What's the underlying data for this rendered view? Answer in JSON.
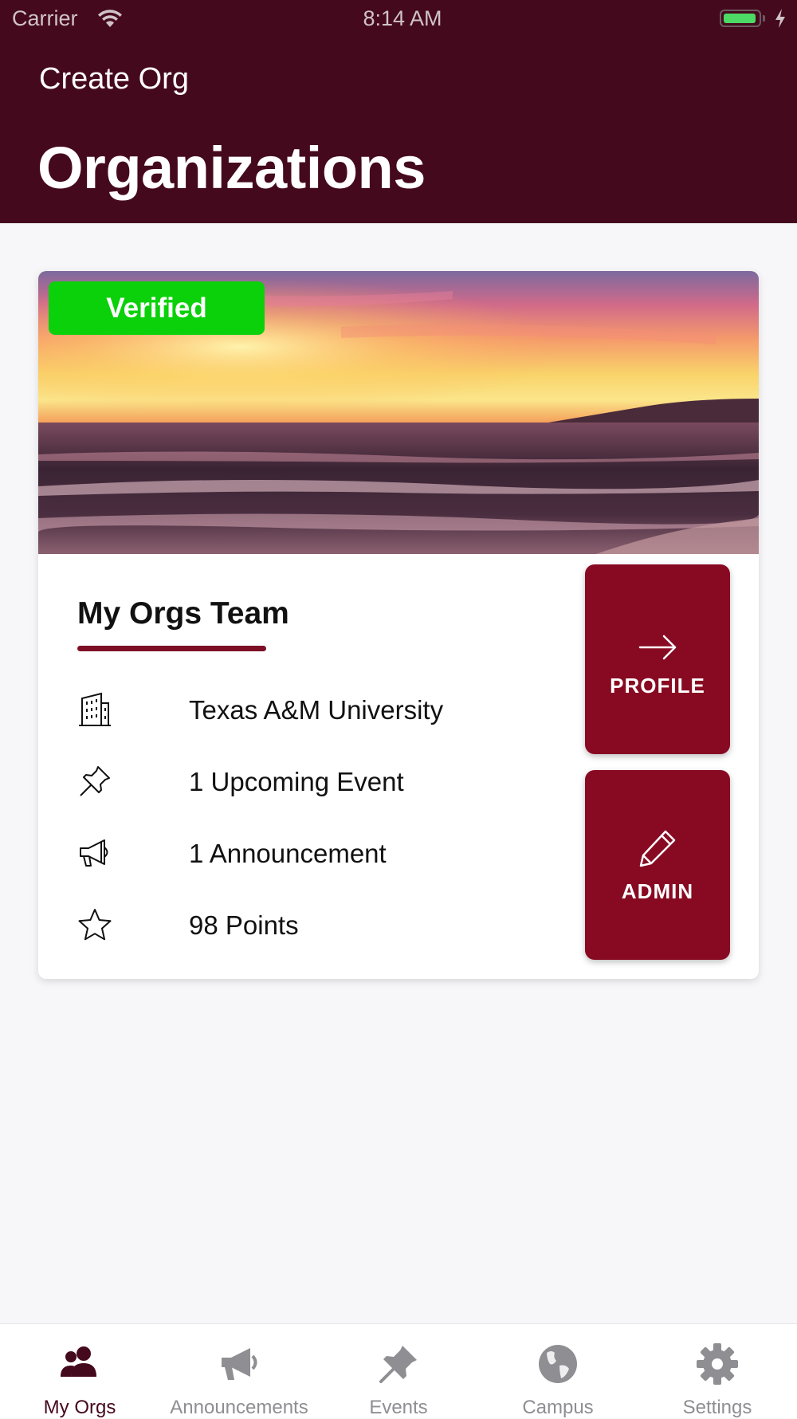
{
  "status_bar": {
    "carrier": "Carrier",
    "time": "8:14 AM",
    "battery_level": 0.95,
    "icons": [
      "wifi-icon",
      "battery-icon",
      "charging-icon"
    ]
  },
  "header": {
    "create_org_label": "Create Org",
    "title": "Organizations",
    "background_color": "#45091e"
  },
  "org_card": {
    "image": "sunset-beach-photo",
    "verified_label": "Verified",
    "verified_color": "#0ad10a",
    "name": "My Orgs Team",
    "accent_color": "#880a22",
    "details": [
      {
        "icon": "building-icon",
        "text": "Texas A&M University"
      },
      {
        "icon": "pin-icon",
        "text": "1 Upcoming Event"
      },
      {
        "icon": "megaphone-icon",
        "text": "1 Announcement"
      },
      {
        "icon": "star-icon",
        "text": "98 Points"
      }
    ],
    "actions": {
      "profile_label": "PROFILE",
      "profile_icon": "arrow-right-icon",
      "admin_label": "ADMIN",
      "admin_icon": "pencil-icon"
    }
  },
  "tab_bar": {
    "active_color": "#45091e",
    "inactive_color": "#8e8e93",
    "tabs": [
      {
        "label": "My Orgs",
        "icon": "users-icon",
        "active": true
      },
      {
        "label": "Announcements",
        "icon": "megaphone-icon",
        "active": false
      },
      {
        "label": "Events",
        "icon": "pin-icon",
        "active": false
      },
      {
        "label": "Campus",
        "icon": "globe-icon",
        "active": false
      },
      {
        "label": "Settings",
        "icon": "gear-icon",
        "active": false
      }
    ]
  }
}
